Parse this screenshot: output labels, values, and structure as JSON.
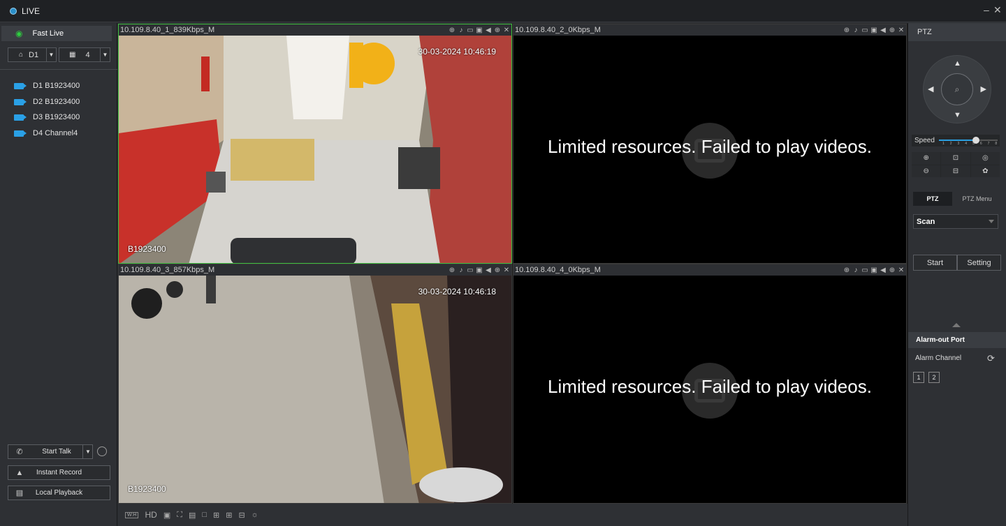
{
  "window": {
    "title": "LIVE",
    "minimize": "–",
    "close": "✕"
  },
  "left": {
    "fast_live": "Fast Live",
    "device_select": "D1",
    "split_select": "4",
    "channels": [
      {
        "label": "D1 B1923400"
      },
      {
        "label": "D2 B1923400"
      },
      {
        "label": "D3 B1923400"
      },
      {
        "label": "D4 Channel4"
      }
    ],
    "start_talk": "Start Talk",
    "instant_record": "Instant Record",
    "local_playback": "Local Playback"
  },
  "panes": [
    {
      "name": "10.109.8.40_1_839Kbps_M",
      "timestamp": "30-03-2024 10:46:19",
      "osd": "B1923400",
      "status": "playing"
    },
    {
      "name": "10.109.8.40_2_0Kbps_M",
      "error": "Limited resources. Failed to play videos.",
      "status": "failed"
    },
    {
      "name": "10.109.8.40_3_857Kbps_M",
      "timestamp": "30-03-2024 10:46:18",
      "osd": "B1923400",
      "status": "playing"
    },
    {
      "name": "10.109.8.40_4_0Kbps_M",
      "error": "Limited resources. Failed to play videos.",
      "status": "failed"
    }
  ],
  "bottombar": {
    "hd": "HD"
  },
  "ptz": {
    "header": "PTZ",
    "speed_label": "Speed",
    "speed_value": 5,
    "speed_max": 8,
    "speed_ticks": "1 2 3 4 5 6 7 8",
    "tab_ptz": "PTZ",
    "tab_menu": "PTZ Menu",
    "mode": "Scan",
    "start": "Start",
    "setting": "Setting"
  },
  "alarm": {
    "header": "Alarm-out Port",
    "channel_label": "Alarm Channel",
    "ports": [
      "1",
      "2"
    ]
  },
  "colors": {
    "active_border": "#3fbf3f",
    "accent": "#2a9fe0"
  }
}
